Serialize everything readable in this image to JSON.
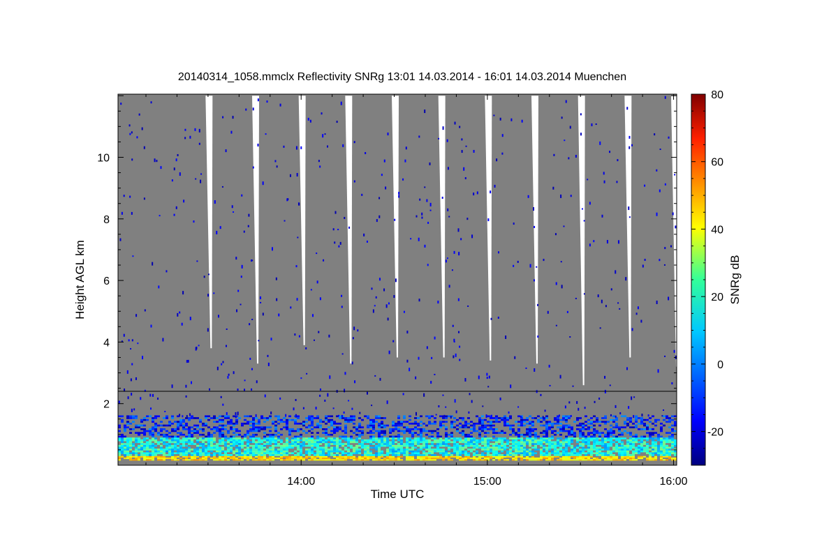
{
  "chart_data": {
    "type": "heatmap",
    "title": "20140314_1058.mmclx Reflectivity SNRg   13:01 14.03.2014 - 16:01 14.03.2014 Muenchen",
    "xlabel": "Time UTC",
    "ylabel": "Height AGL km",
    "colorbar_label": "SNRg dB",
    "x_start": "13:01",
    "x_end": "16:01",
    "x_ticks": [
      "14:00",
      "15:00",
      "16:00"
    ],
    "y_range_km": [
      0,
      12.05
    ],
    "y_ticks": [
      2,
      4,
      6,
      8,
      10
    ],
    "colorbar_range_db": [
      -30,
      80
    ],
    "colorbar_ticks": [
      -20,
      0,
      20,
      40,
      60,
      80
    ],
    "colormap": "jet",
    "background_color": "#808080",
    "mode_boundary_km": 2.4,
    "grid": false,
    "scan_gaps": [
      {
        "time": "13:31",
        "top_km": 12.0,
        "bottom_km": 3.8
      },
      {
        "time": "13:46",
        "top_km": 12.0,
        "bottom_km": 3.3
      },
      {
        "time": "14:01",
        "top_km": 12.0,
        "bottom_km": 3.9
      },
      {
        "time": "14:16",
        "top_km": 12.0,
        "bottom_km": 3.3
      },
      {
        "time": "14:31",
        "top_km": 12.0,
        "bottom_km": 3.5
      },
      {
        "time": "14:46",
        "top_km": 12.0,
        "bottom_km": 3.5
      },
      {
        "time": "15:01",
        "top_km": 12.0,
        "bottom_km": 3.4
      },
      {
        "time": "15:16",
        "top_km": 12.0,
        "bottom_km": 3.3
      },
      {
        "time": "15:31",
        "top_km": 12.0,
        "bottom_km": 2.6
      },
      {
        "time": "15:46",
        "top_km": 12.0,
        "bottom_km": 3.5
      },
      {
        "time": "16:01",
        "top_km": 12.0,
        "bottom_km": 3.2
      }
    ],
    "echo_layers": [
      {
        "layer": "surface",
        "height_range_km": [
          0.15,
          0.3
        ],
        "snr_db": [
          35,
          50
        ]
      },
      {
        "layer": "boundary_layer",
        "height_range_km": [
          0.3,
          0.9
        ],
        "snr_db": [
          0,
          25
        ]
      },
      {
        "layer": "upper_boundary_layer",
        "height_range_km": [
          0.9,
          1.6
        ],
        "snr_db": [
          -25,
          0
        ]
      },
      {
        "layer": "aloft_noise",
        "height_range_km": [
          1.6,
          12.0
        ],
        "snr_db": [
          -25,
          -15
        ]
      }
    ]
  }
}
